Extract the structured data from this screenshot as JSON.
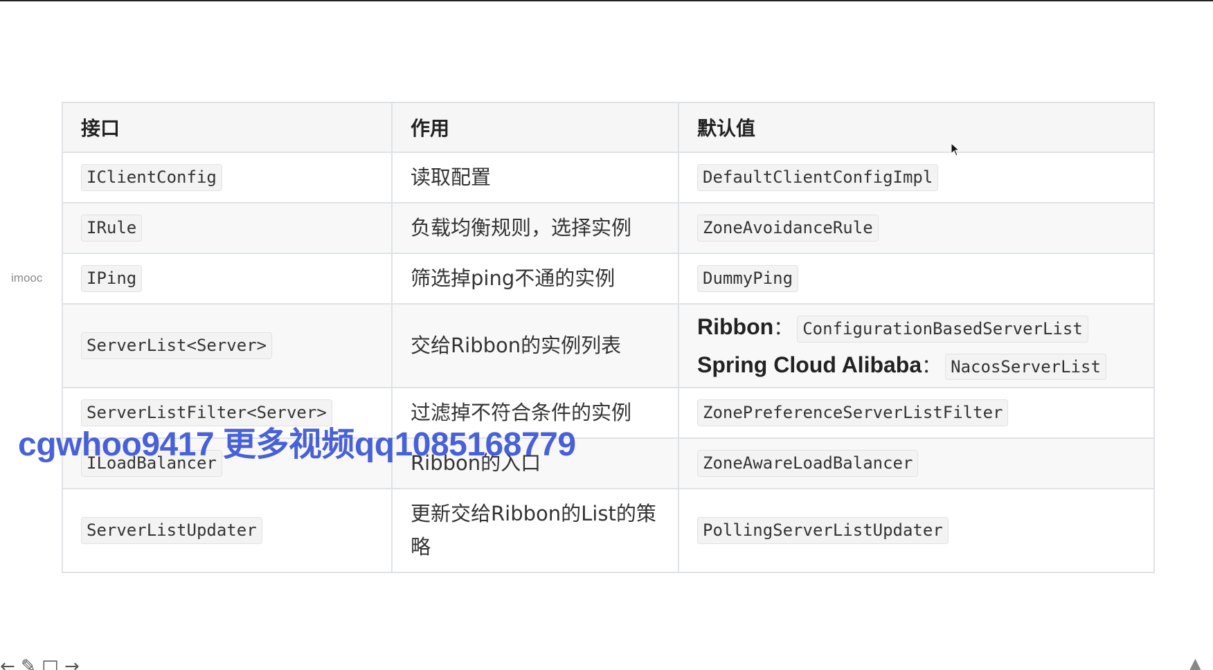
{
  "side_label": "imooc",
  "table": {
    "headers": [
      "接口",
      "作用",
      "默认值"
    ],
    "rows": [
      {
        "interface": "IClientConfig",
        "purpose": "读取配置",
        "default": "DefaultClientConfigImpl"
      },
      {
        "interface": "IRule",
        "purpose": "负载均衡规则，选择实例",
        "default": "ZoneAvoidanceRule"
      },
      {
        "interface": "IPing",
        "purpose": "筛选掉ping不通的实例",
        "default": "DummyPing"
      },
      {
        "interface": "ServerList<Server>",
        "purpose": "交给Ribbon的实例列表",
        "default_lines": [
          {
            "label": "Ribbon",
            "value": "ConfigurationBasedServerList"
          },
          {
            "label": "Spring Cloud Alibaba",
            "value": "NacosServerList"
          }
        ]
      },
      {
        "interface": "ServerListFilter<Server>",
        "purpose": "过滤掉不符合条件的实例",
        "default": "ZonePreferenceServerListFilter"
      },
      {
        "interface": "ILoadBalancer",
        "purpose": "Ribbon的入口",
        "default": "ZoneAwareLoadBalancer"
      },
      {
        "interface": "ServerListUpdater",
        "purpose": "更新交给Ribbon的List的策略",
        "default": "PollingServerListUpdater"
      }
    ],
    "colon": "："
  },
  "watermark": "cgwhoo9417 更多视频qq1085168779",
  "icons": {
    "cursor": "mouse-pointer-icon"
  }
}
